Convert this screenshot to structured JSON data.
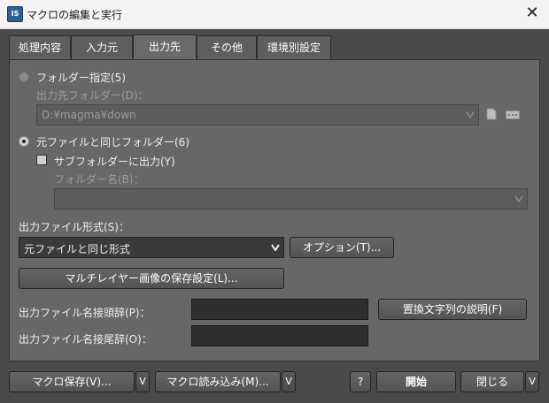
{
  "window": {
    "title": "マクロの編集と実行",
    "app_icon_text": "IS",
    "close_glyph": "✕"
  },
  "tabs": [
    {
      "label": "処理内容",
      "active": false
    },
    {
      "label": "入力元",
      "active": false
    },
    {
      "label": "出力先",
      "active": true
    },
    {
      "label": "その他",
      "active": false
    },
    {
      "label": "環境別設定",
      "active": false
    }
  ],
  "output": {
    "folder_radio_label": "フォルダー指定(5)",
    "folder_radio_checked": false,
    "dest_folder_label": "出力先フォルダー(D)：",
    "dest_folder_value": "D:¥magma¥down",
    "same_folder_radio_label": "元ファイルと同じフォルダー(6)",
    "same_folder_radio_checked": true,
    "subfolder_checkbox_label": "サブフォルダーに出力(Y)",
    "subfolder_checked": false,
    "folder_name_label": "フォルダー名(B)：",
    "folder_name_value": "",
    "format_label": "出力ファイル形式(S)：",
    "format_value": "元ファイルと同じ形式",
    "option_button": "オプション(T)...",
    "multilayer_button": "マルチレイヤー画像の保存設定(L)...",
    "prefix_label": "出力ファイル名接頭辞(P)：",
    "prefix_value": "",
    "suffix_label": "出力ファイル名接尾辞(O)：",
    "suffix_value": "",
    "replace_help_button": "置換文字列の説明(F)"
  },
  "footer": {
    "save_macro": "マクロ保存(V)...",
    "load_macro": "マクロ読み込み(M)...",
    "help": "?",
    "start": "開始",
    "close": "閉じる",
    "dropdown_glyph": "V"
  },
  "icons": {
    "dropdown_arrow": "chevron-down-icon",
    "browse_folder": "folder-icon",
    "more": "ellipsis-icon"
  }
}
